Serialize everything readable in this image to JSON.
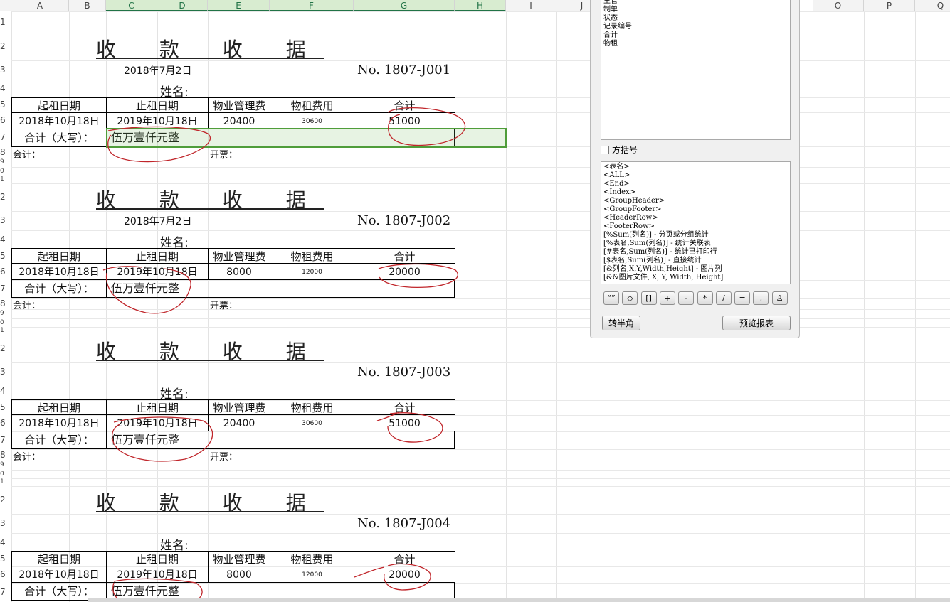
{
  "columns": [
    "A",
    "B",
    "C",
    "D",
    "E",
    "F",
    "G",
    "H",
    "I",
    "J",
    "O",
    "P",
    "Q"
  ],
  "row_numbers": [
    "1",
    "2",
    "3",
    "4",
    "5",
    "6",
    "7",
    "8",
    "9",
    "0",
    "1",
    "2",
    "3",
    "4",
    "5",
    "6",
    "7",
    "8",
    "9",
    "0",
    "1",
    "2",
    "3",
    "4",
    "5",
    "6",
    "7",
    "8",
    "9",
    "0",
    "1",
    "2",
    "3",
    "4",
    "5",
    "6",
    "7"
  ],
  "receipts": [
    {
      "title": "收 款 收 据",
      "date": "2018年7月2日",
      "number": "No. 1807-J001",
      "name_label": "姓名:",
      "headers": [
        "起租日期",
        "止租日期",
        "物业管理费",
        "物租费用",
        "合计"
      ],
      "row": [
        "2018年10月18日",
        "2019年10月18日",
        "20400",
        "30600",
        "51000"
      ],
      "total_label": "合计（大写）：",
      "total_text": "伍万壹仟元整",
      "accountant": "会计：",
      "invoice": "开票："
    },
    {
      "title": "收 款 收 据",
      "date": "2018年7月2日",
      "number": "No. 1807-J002",
      "name_label": "姓名:",
      "headers": [
        "起租日期",
        "止租日期",
        "物业管理费",
        "物租费用",
        "合计"
      ],
      "row": [
        "2018年10月18日",
        "2019年10月18日",
        "8000",
        "12000",
        "20000"
      ],
      "total_label": "合计（大写）：",
      "total_text": "伍万壹仟元整",
      "accountant": "会计：",
      "invoice": "开票："
    },
    {
      "title": "收 款 收 据",
      "date": "",
      "number": "No. 1807-J003",
      "name_label": "姓名:",
      "headers": [
        "起租日期",
        "止租日期",
        "物业管理费",
        "物租费用",
        "合计"
      ],
      "row": [
        "2018年10月18日",
        "2019年10月18日",
        "20400",
        "30600",
        "51000"
      ],
      "total_label": "合计（大写）：",
      "total_text": "伍万壹仟元整",
      "accountant": "会计：",
      "invoice": "开票："
    },
    {
      "title": "收 款 收 据",
      "date": "",
      "number": "No. 1807-J004",
      "name_label": "姓名:",
      "headers": [
        "起租日期",
        "止租日期",
        "物业管理费",
        "物租费用",
        "合计"
      ],
      "row": [
        "2018年10月18日",
        "2019年10月18日",
        "8000",
        "12000",
        "20000"
      ],
      "total_label": "合计（大写）：",
      "total_text": "伍万壹仟元整",
      "accountant": "",
      "invoice": ""
    }
  ],
  "panel": {
    "field_list": [
      "主管",
      "制单",
      "状态",
      "记录编号",
      "合计",
      "物租"
    ],
    "bracket_checkbox": "方括号",
    "syntax_list": [
      "<表名>",
      "<ALL>",
      "<End>",
      "<Index>",
      "<GroupHeader>",
      "<GroupFooter>",
      "<HeaderRow>",
      "<FooterRow>",
      "[%Sum(列名)] - 分页或分组统计",
      "[%表名,Sum(列名)] - 统计关联表",
      "[#表名,Sum(列名)] - 统计已打印行",
      "[$表名,Sum(列名)] - 直接统计",
      "[&列名,X,Y,Width,Height] - 图片列",
      "[&&图片文件, X, Y, Width, Height]"
    ],
    "symbol_buttons": [
      "“”",
      "◇",
      "[]",
      "+",
      "-",
      "*",
      "/",
      "=",
      ",",
      "♙"
    ],
    "btn_convert": "转半角",
    "btn_preview": "预览报表"
  },
  "ink_color": "#c0262b",
  "selection_color": "#4f9d3a"
}
